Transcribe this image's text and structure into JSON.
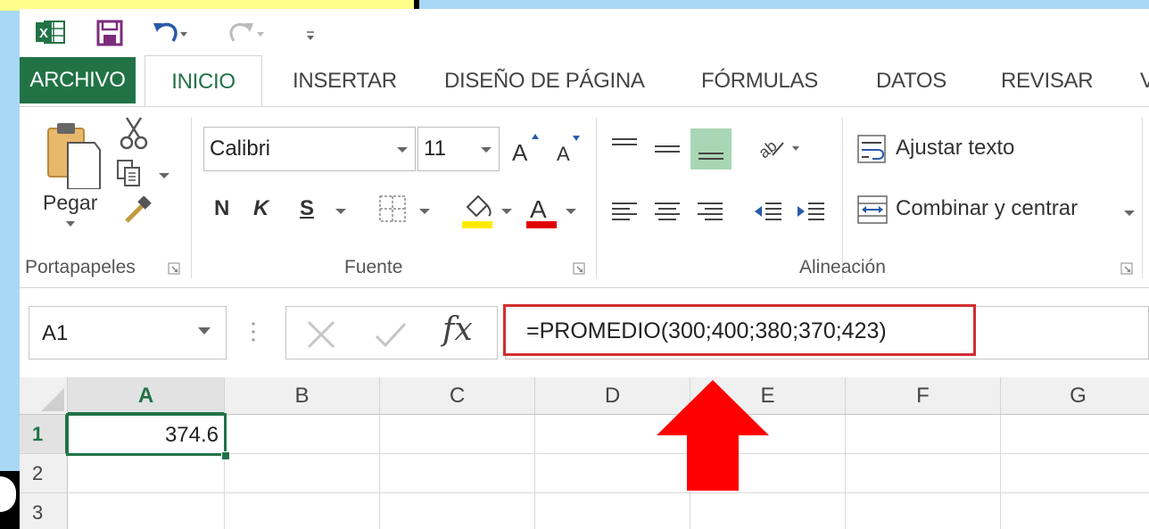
{
  "tabs": {
    "archivo": "ARCHIVO",
    "inicio": "INICIO",
    "insertar": "INSERTAR",
    "diseno": "DISEÑO DE PÁGINA",
    "formulas": "FÓRMULAS",
    "datos": "DATOS",
    "revisar": "REVISAR",
    "vista": "V"
  },
  "ribbon": {
    "clipboard": {
      "paste_label": "Pegar",
      "group_label": "Portapapeles"
    },
    "font": {
      "font_name": "Calibri",
      "font_size": "11",
      "bold": "N",
      "italic": "K",
      "underline": "S",
      "group_label": "Fuente"
    },
    "alignment": {
      "wrap_text": "Ajustar texto",
      "merge_center": "Combinar y centrar",
      "group_label": "Alineación"
    }
  },
  "formula_bar": {
    "name_box": "A1",
    "fx": "fx",
    "formula": "=PROMEDIO(300;400;380;370;423)"
  },
  "grid": {
    "columns": [
      "A",
      "B",
      "C",
      "D",
      "E",
      "F",
      "G"
    ],
    "rows": [
      "1",
      "2",
      "3"
    ],
    "a1_value": "374.6"
  },
  "colors": {
    "excel_green": "#217346",
    "highlight_red": "#d32f2f",
    "arrow_red": "#ff0000"
  }
}
